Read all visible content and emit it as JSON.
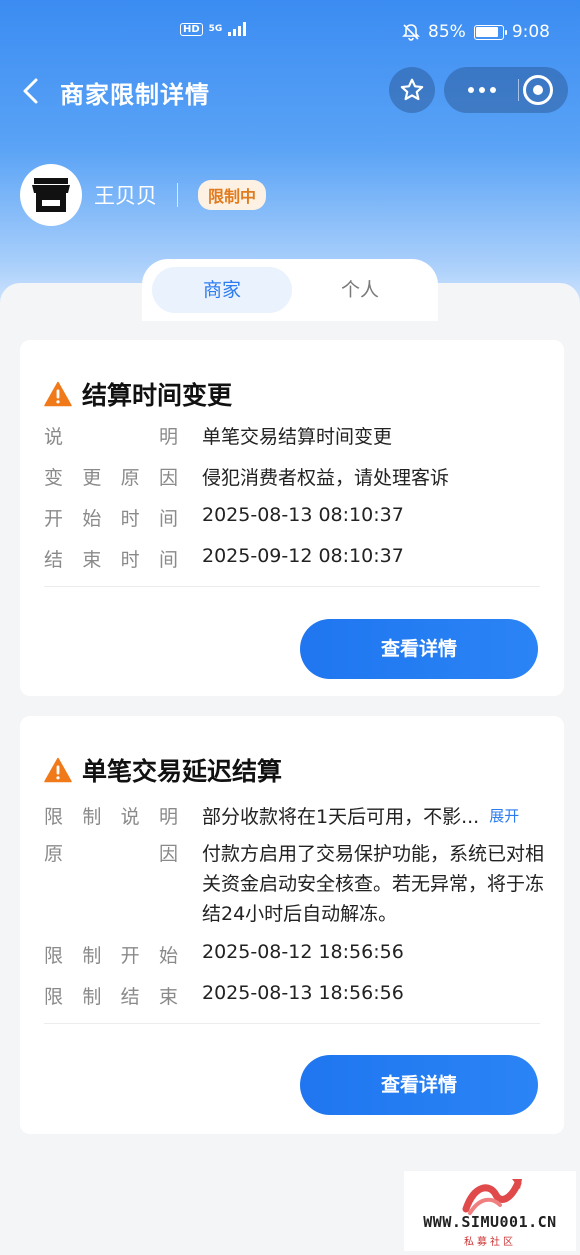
{
  "status_bar": {
    "hd": "HD",
    "network": "5G",
    "battery": "85%",
    "battery_level": 0.85,
    "time": "9:08"
  },
  "nav": {
    "title": "商家限制详情"
  },
  "merchant": {
    "name": "王贝贝",
    "status_badge": "限制中"
  },
  "tabs": [
    "商家",
    "个人"
  ],
  "cards": [
    {
      "title": "结算时间变更",
      "rows": [
        {
          "label": "说明",
          "value": "单笔交易结算时间变更"
        },
        {
          "label": "变更原因",
          "value": "侵犯消费者权益，请处理客诉"
        },
        {
          "label": "开始时间",
          "value": "2025-08-13 08:10:37"
        },
        {
          "label": "结束时间",
          "value": "2025-09-12 08:10:37"
        }
      ],
      "button": "查看详情"
    },
    {
      "title": "单笔交易延迟结算",
      "rows": [
        {
          "label": "限制说明",
          "value": "部分收款将在1天后可用，不影...",
          "link": "展开"
        },
        {
          "label": "原因",
          "value": "付款方启用了交易保护功能，系统已对相关资金启动安全核查。若无异常，将于冻结24小时后自动解冻。"
        },
        {
          "label": "限制开始",
          "value": "2025-08-12 18:56:56"
        },
        {
          "label": "限制结束",
          "value": "2025-08-13 18:56:56"
        }
      ],
      "button": "查看详情"
    }
  ],
  "watermark": {
    "text": "WWW.SIMU001.CN",
    "sub": "私募社区"
  },
  "colors": {
    "accent": "#2c7cf0",
    "warning": "#f07a1a",
    "badge_text": "#e07b1e"
  }
}
